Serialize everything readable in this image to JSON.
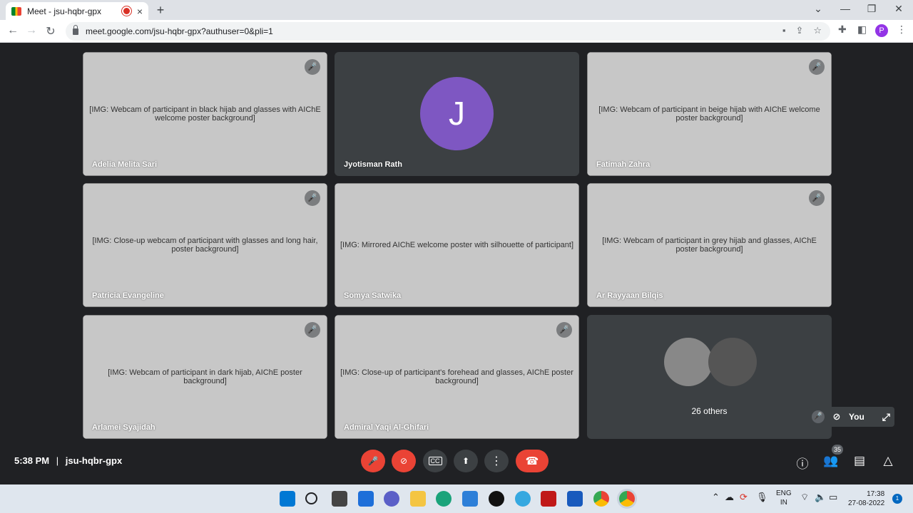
{
  "browser": {
    "tab_title": "Meet - jsu-hqbr-gpx",
    "tab_close": "×",
    "new_tab": "+",
    "url": "meet.google.com/jsu-hqbr-gpx?authuser=0&pli=1",
    "profile_initial": "P",
    "window_controls": {
      "collapse": "⌄",
      "minimize": "—",
      "restore": "❐",
      "close": "✕"
    },
    "nav": {
      "back": "←",
      "forward": "→",
      "reload": "↻"
    }
  },
  "participants": [
    {
      "name": "Adelia Melita Sari",
      "camera": true,
      "muted": true
    },
    {
      "name": "Jyotisman Rath",
      "camera": false,
      "initial": "J",
      "muted": false
    },
    {
      "name": "Fatimah Zahra",
      "camera": true,
      "muted": true
    },
    {
      "name": "Patricia Evangeline",
      "camera": true,
      "muted": true
    },
    {
      "name": "Somya Satwika",
      "camera": true,
      "muted": false
    },
    {
      "name": "Ar Rayyaan Bilqis",
      "camera": true,
      "muted": true
    },
    {
      "name": "Arlamei Syajidah",
      "camera": true,
      "muted": true
    },
    {
      "name": "Admiral Yaqi Al-Ghifari",
      "camera": true,
      "muted": true
    }
  ],
  "others": {
    "label": "26 others"
  },
  "self_view": {
    "label": "You"
  },
  "meeting": {
    "time": "5:38 PM",
    "separator": "|",
    "code": "jsu-hqbr-gpx",
    "people_count": "35"
  },
  "taskbar": {
    "language": "ENG",
    "region": "IN",
    "time": "17:38",
    "date": "27-08-2022",
    "notifications": "1"
  },
  "colors": {
    "meet_background": "#202124",
    "tile_background": "#3c4043",
    "danger_red": "#ea4335",
    "avatar_purple": "#7e57c2",
    "poster_salmon": "#f1a392"
  }
}
